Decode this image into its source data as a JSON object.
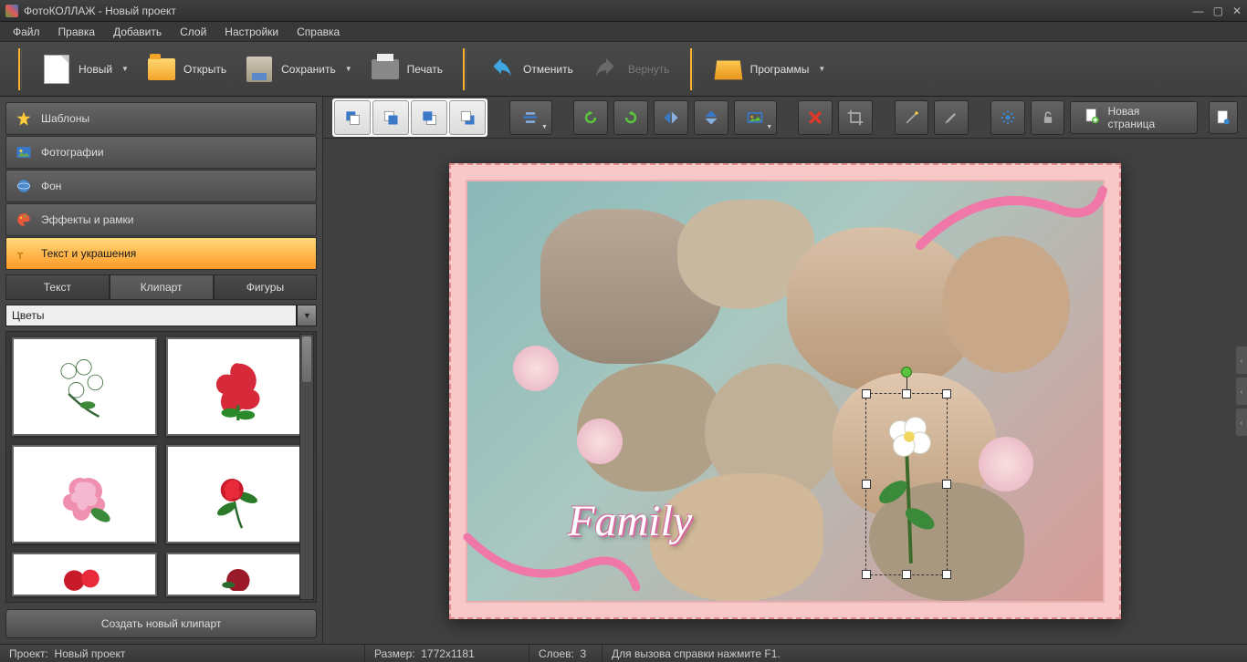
{
  "titlebar": {
    "app": "ФотоКОЛЛАЖ",
    "project": "Новый проект"
  },
  "menu": [
    "Файл",
    "Правка",
    "Добавить",
    "Слой",
    "Настройки",
    "Справка"
  ],
  "toolbar": {
    "new": "Новый",
    "open": "Открыть",
    "save": "Сохранить",
    "print": "Печать",
    "undo": "Отменить",
    "redo": "Вернуть",
    "programs": "Программы"
  },
  "accordion": {
    "templates": "Шаблоны",
    "photos": "Фотографии",
    "background": "Фон",
    "effects": "Эффекты и рамки",
    "text_decor": "Текст и украшения"
  },
  "tabs": {
    "text": "Текст",
    "clipart": "Клипарт",
    "shapes": "Фигуры"
  },
  "combo": {
    "selected": "Цветы"
  },
  "create_clipart": "Создать новый клипарт",
  "sec_toolbar": {
    "new_page": "Новая страница"
  },
  "canvas": {
    "text": "Family"
  },
  "status": {
    "project_label": "Проект:",
    "project_name": "Новый проект",
    "size_label": "Размер:",
    "size_value": "1772x1181",
    "layers_label": "Слоев:",
    "layers_value": "3",
    "help": "Для вызова справки нажмите F1."
  }
}
